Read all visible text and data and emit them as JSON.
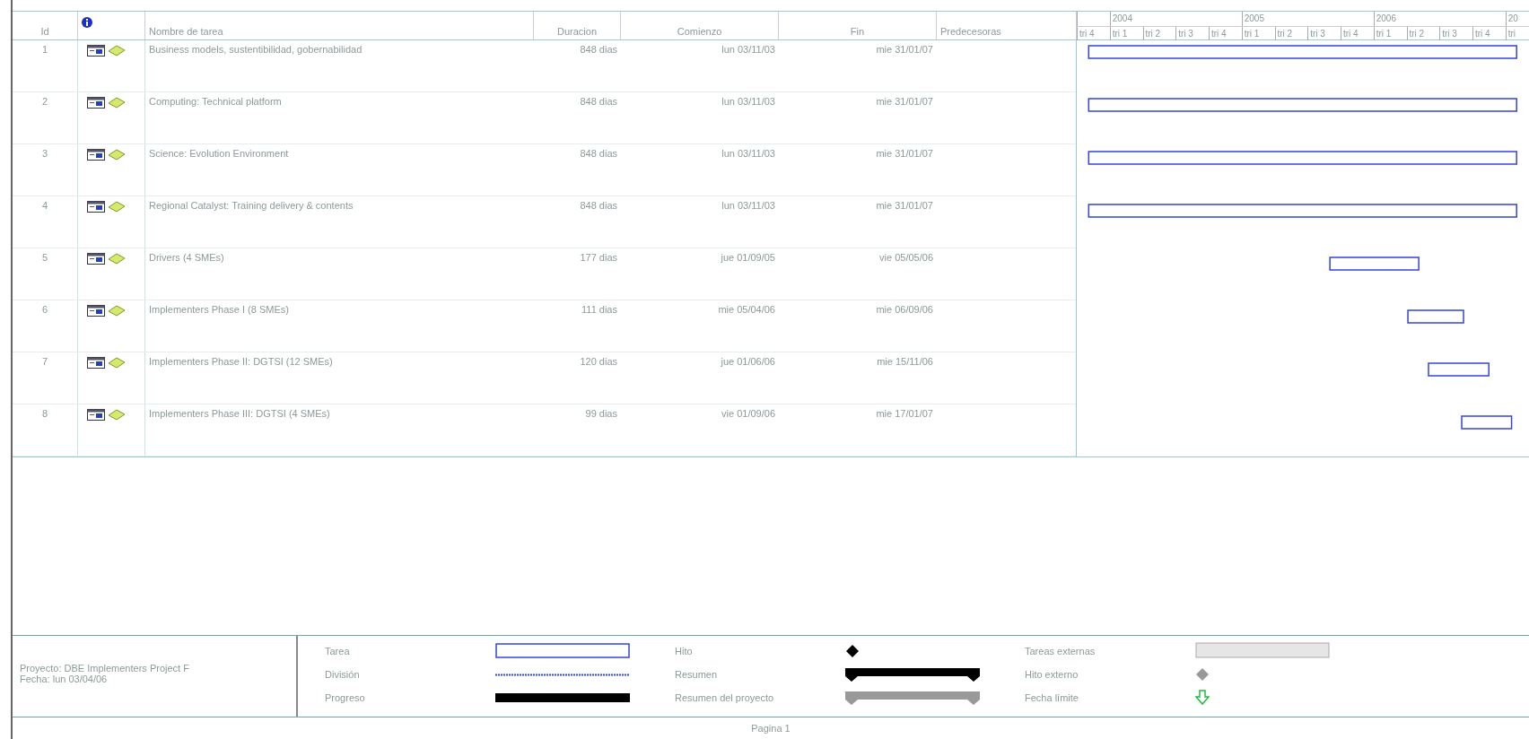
{
  "columns": [
    {
      "label": "Id"
    },
    {
      "kind": "info"
    },
    {
      "label": "Nombre de tarea"
    },
    {
      "label": "Duracion"
    },
    {
      "label": "Comienzo"
    },
    {
      "label": "Fin"
    },
    {
      "label": "Predecesoras"
    }
  ],
  "timescale": [
    {
      "quarters": [
        "tri 4"
      ]
    },
    {
      "label": "2004",
      "quarters": [
        "tri 1",
        "tri 2",
        "tri 3",
        "tri 4"
      ]
    },
    {
      "label": "2005",
      "quarters": [
        "tri 1",
        "tri 2",
        "tri 3",
        "tri 4"
      ]
    },
    {
      "label": "2006",
      "quarters": [
        "tri 1",
        "tri 2",
        "tri 3",
        "tri 4"
      ]
    },
    {
      "label": "20",
      "quarters": [
        "tri"
      ]
    }
  ],
  "tasks": [
    {
      "id": "1",
      "name": "Business models, sustentibilidad, gobernabilidad",
      "duration": "848 dias",
      "start": "lun 03/11/03",
      "finish": "mie 31/01/07"
    },
    {
      "id": "2",
      "name": "Computing: Technical platform",
      "duration": "848 dias",
      "start": "lun 03/11/03",
      "finish": "mie 31/01/07"
    },
    {
      "id": "3",
      "name": "Science: Evolution Environment",
      "duration": "848 dias",
      "start": "lun 03/11/03",
      "finish": "mie 31/01/07"
    },
    {
      "id": "4",
      "name": "Regional Catalyst: Training delivery & contents",
      "duration": "848 dias",
      "start": "lun 03/11/03",
      "finish": "mie 31/01/07"
    },
    {
      "id": "5",
      "name": "Drivers (4 SMEs)",
      "duration": "177 dias",
      "start": "jue 01/09/05",
      "finish": "vie 05/05/06"
    },
    {
      "id": "6",
      "name": "Implementers Phase I (8 SMEs)",
      "duration": "111 dias",
      "start": "mie 05/04/06",
      "finish": "mie 06/09/06"
    },
    {
      "id": "7",
      "name": "Implementers Phase II: DGTSI (12 SMEs)",
      "duration": "120 dias",
      "start": "jue 01/06/06",
      "finish": "mie 15/11/06"
    },
    {
      "id": "8",
      "name": "Implementers Phase III: DGTSI (4 SMEs)",
      "duration": "99 dias",
      "start": "vie 01/09/06",
      "finish": "mie 17/01/07"
    }
  ],
  "project_info": [
    "Proyecto: DBE Implementers Project F",
    "Fecha: lun 03/04/06"
  ],
  "legend": [
    {
      "kind": "task",
      "label": "Tarea"
    },
    {
      "kind": "split",
      "label": "División"
    },
    {
      "kind": "progress",
      "label": "Progreso"
    },
    {
      "kind": "milestone",
      "label": "Hito"
    },
    {
      "kind": "summary",
      "label": "Resumen"
    },
    {
      "kind": "project_summary",
      "label": "Resumen del proyecto"
    },
    {
      "kind": "external_tasks",
      "label": "Tareas externas"
    },
    {
      "kind": "external_milestone",
      "label": "Hito externo"
    },
    {
      "kind": "deadline",
      "label": "Fecha límite"
    }
  ],
  "footer": "Pagina 1"
}
